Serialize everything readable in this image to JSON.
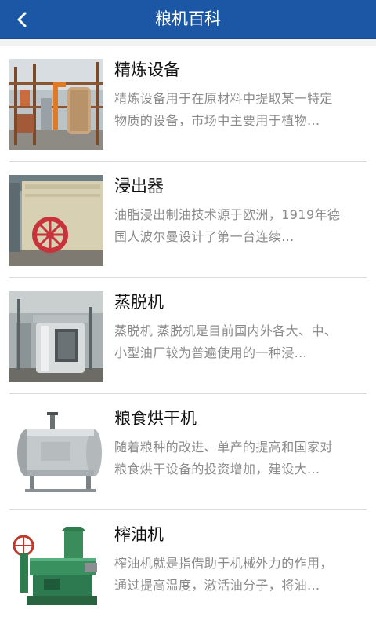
{
  "header": {
    "title": "粮机百科",
    "back_icon": "chevron-left-icon"
  },
  "articles": [
    {
      "title": "精炼设备",
      "desc_line1": "精炼设备用于在原材料中提取某一特定",
      "desc_line2": "物质的设备，市场中主要用于植物...",
      "image": "refinery-tower-image"
    },
    {
      "title": "浸出器",
      "desc_line1": "油脂浸出制油技术源于欧洲，1919年德",
      "desc_line2": "国人波尔曼设计了第一台连续...",
      "image": "extractor-machine-image"
    },
    {
      "title": "蒸脱机",
      "desc_line1": "蒸脱机 蒸脱机是目前国内外各大、中、",
      "desc_line2": "小型油厂较为普遍使用的一种浸...",
      "image": "desolventizer-image"
    },
    {
      "title": "粮食烘干机",
      "desc_line1": "随着粮种的改进、单产的提高和国家对",
      "desc_line2": "粮食烘干设备的投资增加，建设大...",
      "image": "grain-dryer-image"
    },
    {
      "title": "榨油机",
      "desc_line1": "榨油机就是指借助于机械外力的作用，",
      "desc_line2": "通过提高温度，激活油分子，将油...",
      "image": "oil-press-image"
    }
  ],
  "colors": {
    "header_bg": "#1c57a6",
    "title_text": "#111111",
    "desc_text": "#8a8a8a"
  }
}
